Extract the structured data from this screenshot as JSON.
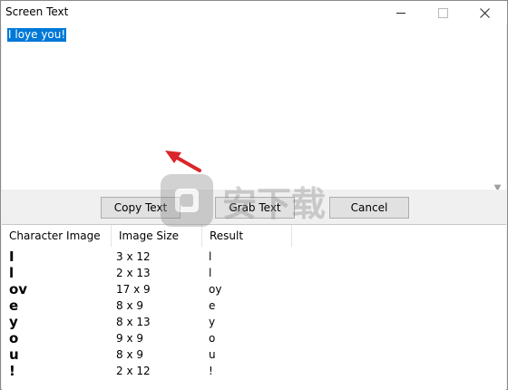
{
  "window": {
    "title": "Screen Text"
  },
  "textbox": {
    "selected_text": "I loye you!"
  },
  "buttons": {
    "copy": "Copy Text",
    "grab": "Grab Text",
    "cancel": "Cancel"
  },
  "table": {
    "headers": [
      "Character Image",
      "Image Size",
      "Result"
    ],
    "rows": [
      {
        "image": "I",
        "size": "3 x 12",
        "result": "l"
      },
      {
        "image": "l",
        "size": "2 x 13",
        "result": "l"
      },
      {
        "image": "ov",
        "size": "17 x 9",
        "result": "oy"
      },
      {
        "image": "e",
        "size": "8 x 9",
        "result": "e"
      },
      {
        "image": "y",
        "size": "8 x 13",
        "result": "y"
      },
      {
        "image": "o",
        "size": "9 x 9",
        "result": "o"
      },
      {
        "image": "u",
        "size": "8 x 9",
        "result": "u"
      },
      {
        "image": "!",
        "size": "2 x 12",
        "result": "!"
      }
    ]
  },
  "colors": {
    "selection": "#0078d7",
    "arrow": "#d9262a"
  },
  "icons": [
    "minimize-icon",
    "maximize-icon",
    "close-icon",
    "scroll-left-icon",
    "scroll-right-icon",
    "scroll-down-icon"
  ],
  "watermark_text": "安下载"
}
